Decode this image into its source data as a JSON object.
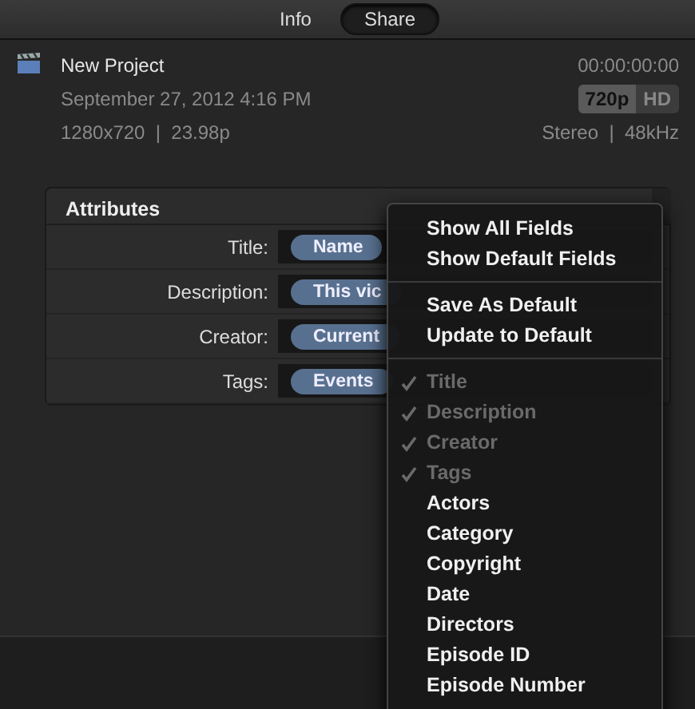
{
  "tabs": [
    {
      "label": "Info",
      "selected": false
    },
    {
      "label": "Share",
      "selected": true
    }
  ],
  "project": {
    "name": "New Project",
    "timecode": "00:00:00:00",
    "date": "September 27, 2012 4:16 PM",
    "format": "1280x720  |  23.98p",
    "resolution": "720p",
    "quality": "HD",
    "audio": "Stereo  |  48kHz"
  },
  "attributes": {
    "title": "Attributes",
    "rows": [
      {
        "label": "Title:",
        "token": "Name"
      },
      {
        "label": "Description:",
        "token": "This vic"
      },
      {
        "label": "Creator:",
        "token": "Current"
      },
      {
        "label": "Tags:",
        "token": "Events"
      }
    ]
  },
  "menu": [
    {
      "kind": "item",
      "label": "Show All Fields",
      "checked": false,
      "disabled": false
    },
    {
      "kind": "item",
      "label": "Show Default Fields",
      "checked": false,
      "disabled": false
    },
    {
      "kind": "separator"
    },
    {
      "kind": "item",
      "label": "Save As Default",
      "checked": false,
      "disabled": false
    },
    {
      "kind": "item",
      "label": "Update to Default",
      "checked": false,
      "disabled": false
    },
    {
      "kind": "separator"
    },
    {
      "kind": "item",
      "label": "Title",
      "checked": true,
      "disabled": true
    },
    {
      "kind": "item",
      "label": "Description",
      "checked": true,
      "disabled": true
    },
    {
      "kind": "item",
      "label": "Creator",
      "checked": true,
      "disabled": true
    },
    {
      "kind": "item",
      "label": "Tags",
      "checked": true,
      "disabled": true
    },
    {
      "kind": "item",
      "label": "Actors",
      "checked": false,
      "disabled": false
    },
    {
      "kind": "item",
      "label": "Category",
      "checked": false,
      "disabled": false
    },
    {
      "kind": "item",
      "label": "Copyright",
      "checked": false,
      "disabled": false
    },
    {
      "kind": "item",
      "label": "Date",
      "checked": false,
      "disabled": false
    },
    {
      "kind": "item",
      "label": "Directors",
      "checked": false,
      "disabled": false
    },
    {
      "kind": "item",
      "label": "Episode ID",
      "checked": false,
      "disabled": false
    },
    {
      "kind": "item",
      "label": "Episode Number",
      "checked": false,
      "disabled": false
    }
  ]
}
